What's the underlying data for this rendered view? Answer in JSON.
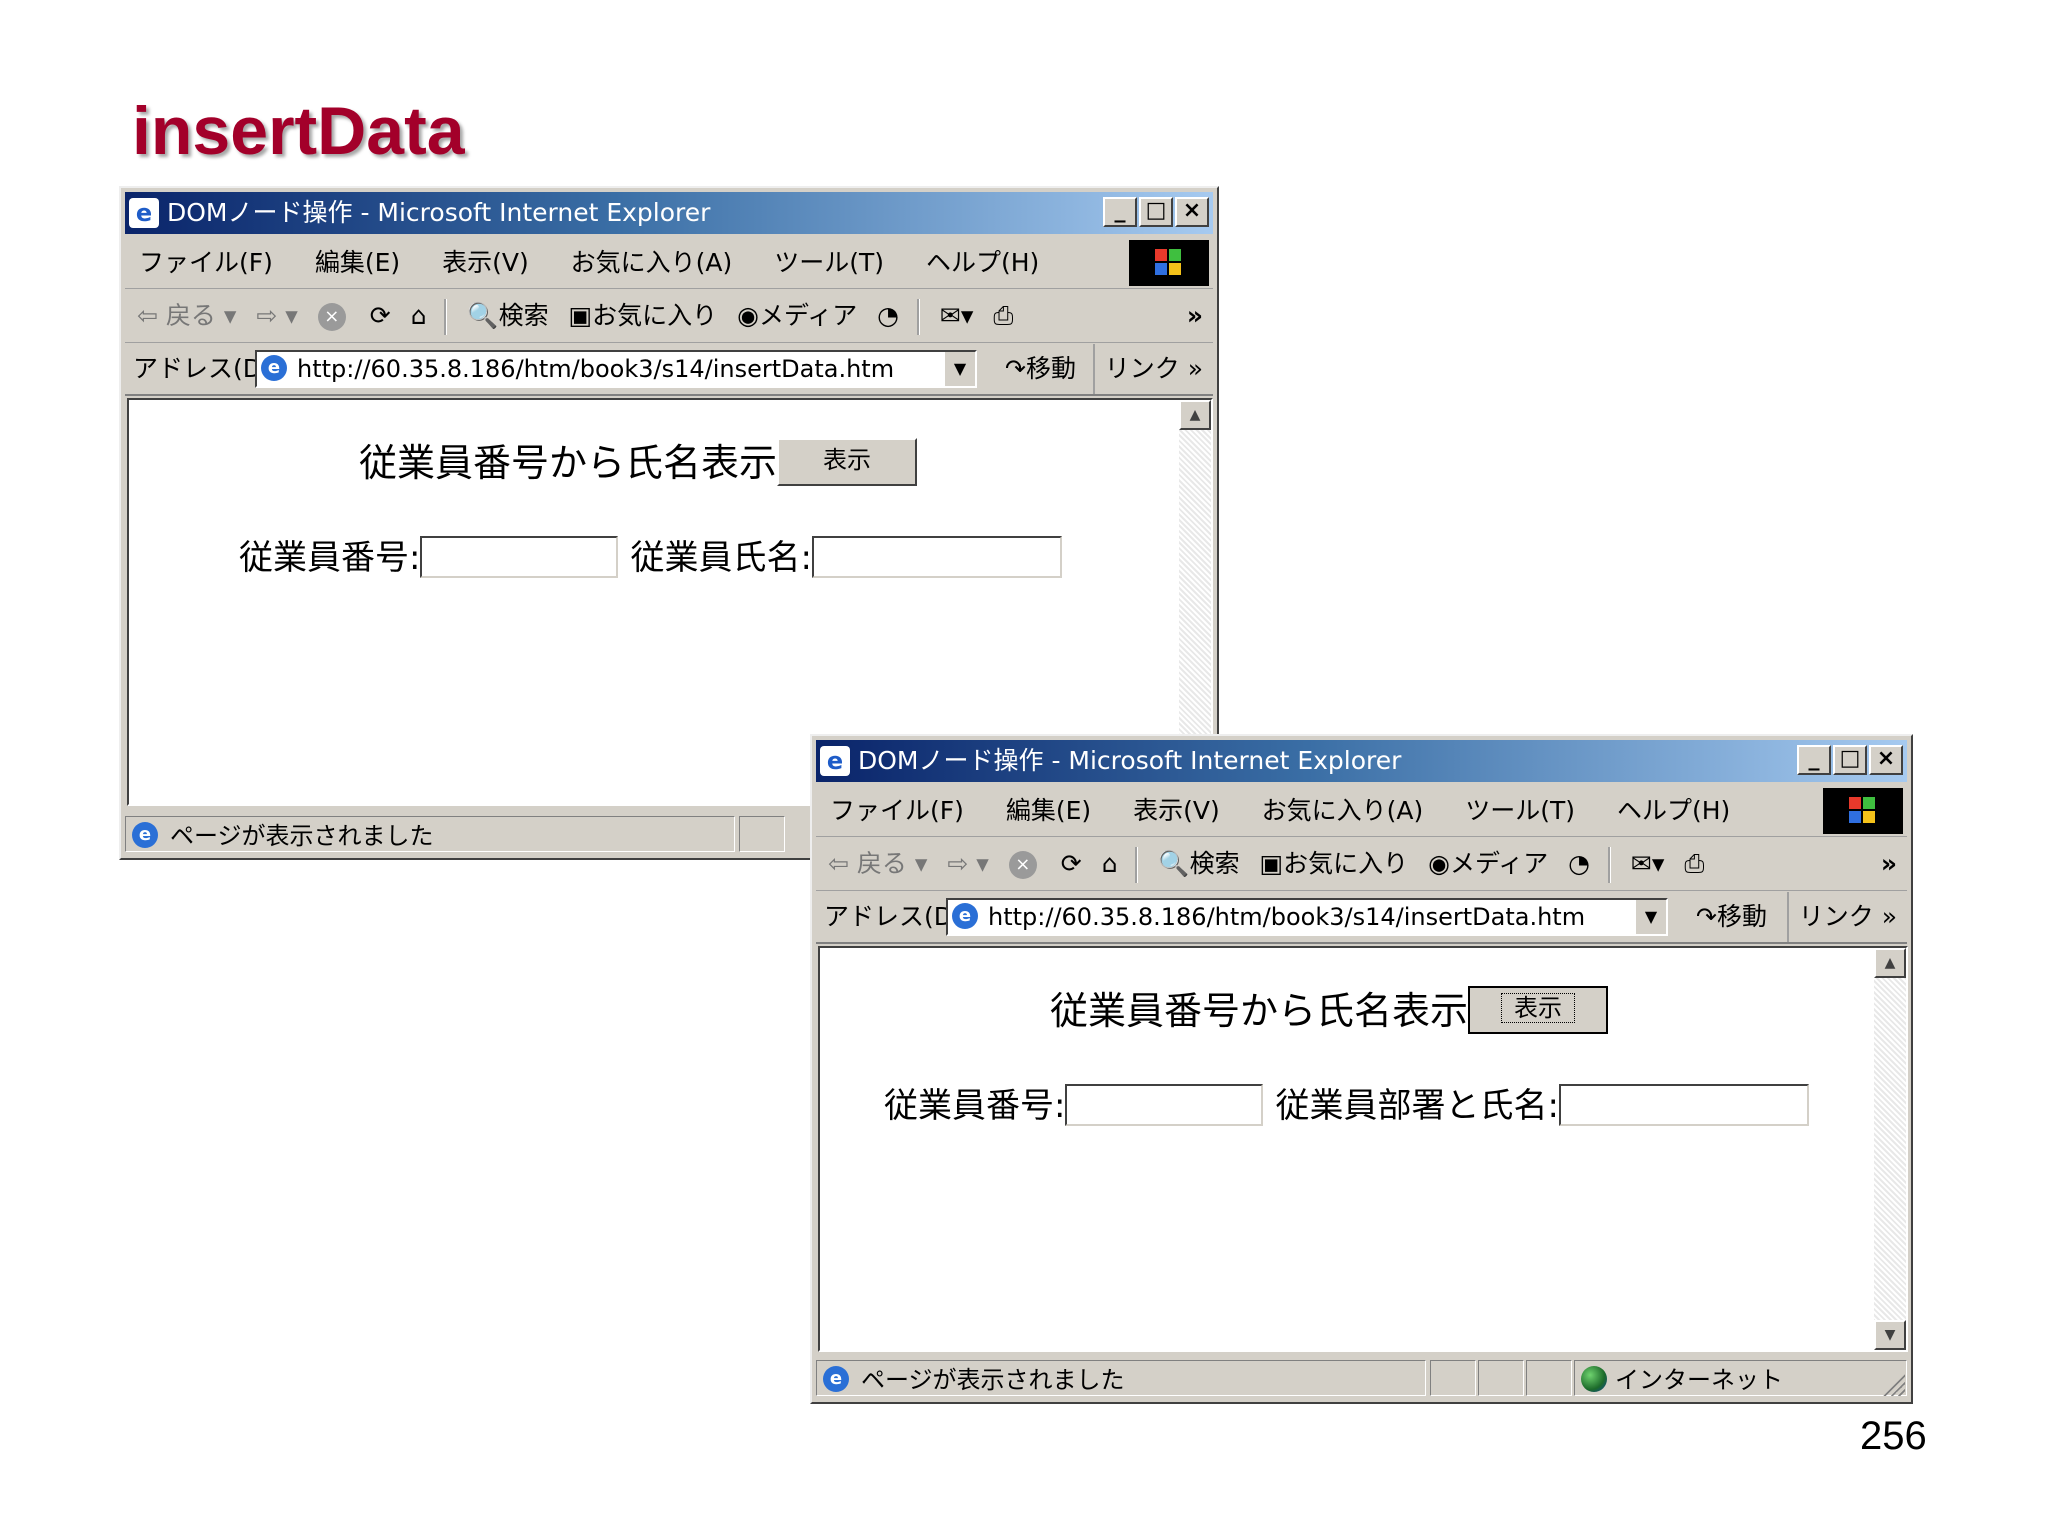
{
  "slide": {
    "title": "insertData",
    "page_number": "256"
  },
  "window1": {
    "title": "DOMノード操作 - Microsoft Internet Explorer",
    "menu": [
      "ファイル(F)",
      "編集(E)",
      "表示(V)",
      "お気に入り(A)",
      "ツール(T)",
      "ヘルプ(H)"
    ],
    "toolbar": {
      "back": "戻る",
      "search": "検索",
      "favorites": "お気に入り",
      "media": "メディア"
    },
    "address": {
      "label": "アドレス(D)",
      "url": "http://60.35.8.186/htm/book3/s14/insertData.htm",
      "go": "移動",
      "links": "リンク"
    },
    "page": {
      "heading": "従業員番号から氏名表示",
      "show_button": "表示",
      "label_id": "従業員番号:",
      "label_name": "従業員氏名:",
      "value_id": "",
      "value_name": ""
    },
    "status": {
      "text": "ページが表示されました"
    }
  },
  "window2": {
    "title": "DOMノード操作 - Microsoft Internet Explorer",
    "menu": [
      "ファイル(F)",
      "編集(E)",
      "表示(V)",
      "お気に入り(A)",
      "ツール(T)",
      "ヘルプ(H)"
    ],
    "toolbar": {
      "back": "戻る",
      "search": "検索",
      "favorites": "お気に入り",
      "media": "メディア"
    },
    "address": {
      "label": "アドレス(D)",
      "url": "http://60.35.8.186/htm/book3/s14/insertData.htm",
      "go": "移動",
      "links": "リンク"
    },
    "page": {
      "heading": "従業員番号から氏名表示",
      "show_button": "表示",
      "label_id": "従業員番号:",
      "label_name": "従業員部署と氏名:",
      "value_id": "",
      "value_name": ""
    },
    "status": {
      "text": "ページが表示されました",
      "zone": "インターネット"
    }
  },
  "icons": [
    "ie-icon",
    "back-arrow-icon",
    "forward-arrow-icon",
    "stop-icon",
    "refresh-icon",
    "home-icon",
    "search-icon",
    "favorites-icon",
    "media-icon",
    "history-icon",
    "mail-icon",
    "print-icon",
    "go-icon",
    "globe-icon"
  ],
  "colors": {
    "title_red": "#a3002a",
    "titlebar_start": "#0a246a",
    "titlebar_end": "#a6caf0",
    "chrome": "#d4d0c8"
  }
}
